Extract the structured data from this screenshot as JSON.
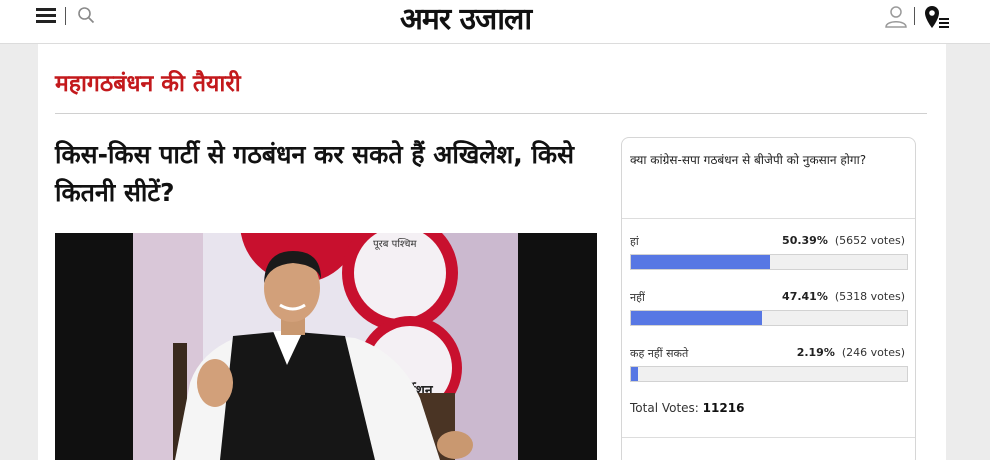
{
  "header": {
    "logo": "अमर उजाला",
    "icons": [
      "menu-icon",
      "search-icon",
      "user-icon",
      "location-icon"
    ]
  },
  "section": {
    "title": "महागठबंधन की तैयारी"
  },
  "article": {
    "headline": "किस-किस पार्टी से गठबंधन कर सकते हैं अखिलेश, किसे कितनी सीटें?"
  },
  "photo": {
    "banner_text_top": "पूरब पश्चिम",
    "banner_text_bottom": "र्जेशन"
  },
  "poll": {
    "question": "क्या कांग्रेस-सपा गठबंधन से बीजेपी को नुकसान होगा?",
    "options": [
      {
        "label": "हां",
        "percent": "50.39%",
        "votes": "(5652 votes)",
        "share": 0.5039
      },
      {
        "label": "नहीं",
        "percent": "47.41%",
        "votes": "(5318 votes)",
        "share": 0.4741
      },
      {
        "label": "कह नहीं सकते",
        "percent": "2.19%",
        "votes": "(246 votes)",
        "share": 0.0219
      }
    ],
    "total_label": "Total Votes:",
    "total_value": "11216",
    "bar_color": "#5777e4"
  },
  "colors": {
    "accent": "#c3191c",
    "background": "#ececec"
  }
}
